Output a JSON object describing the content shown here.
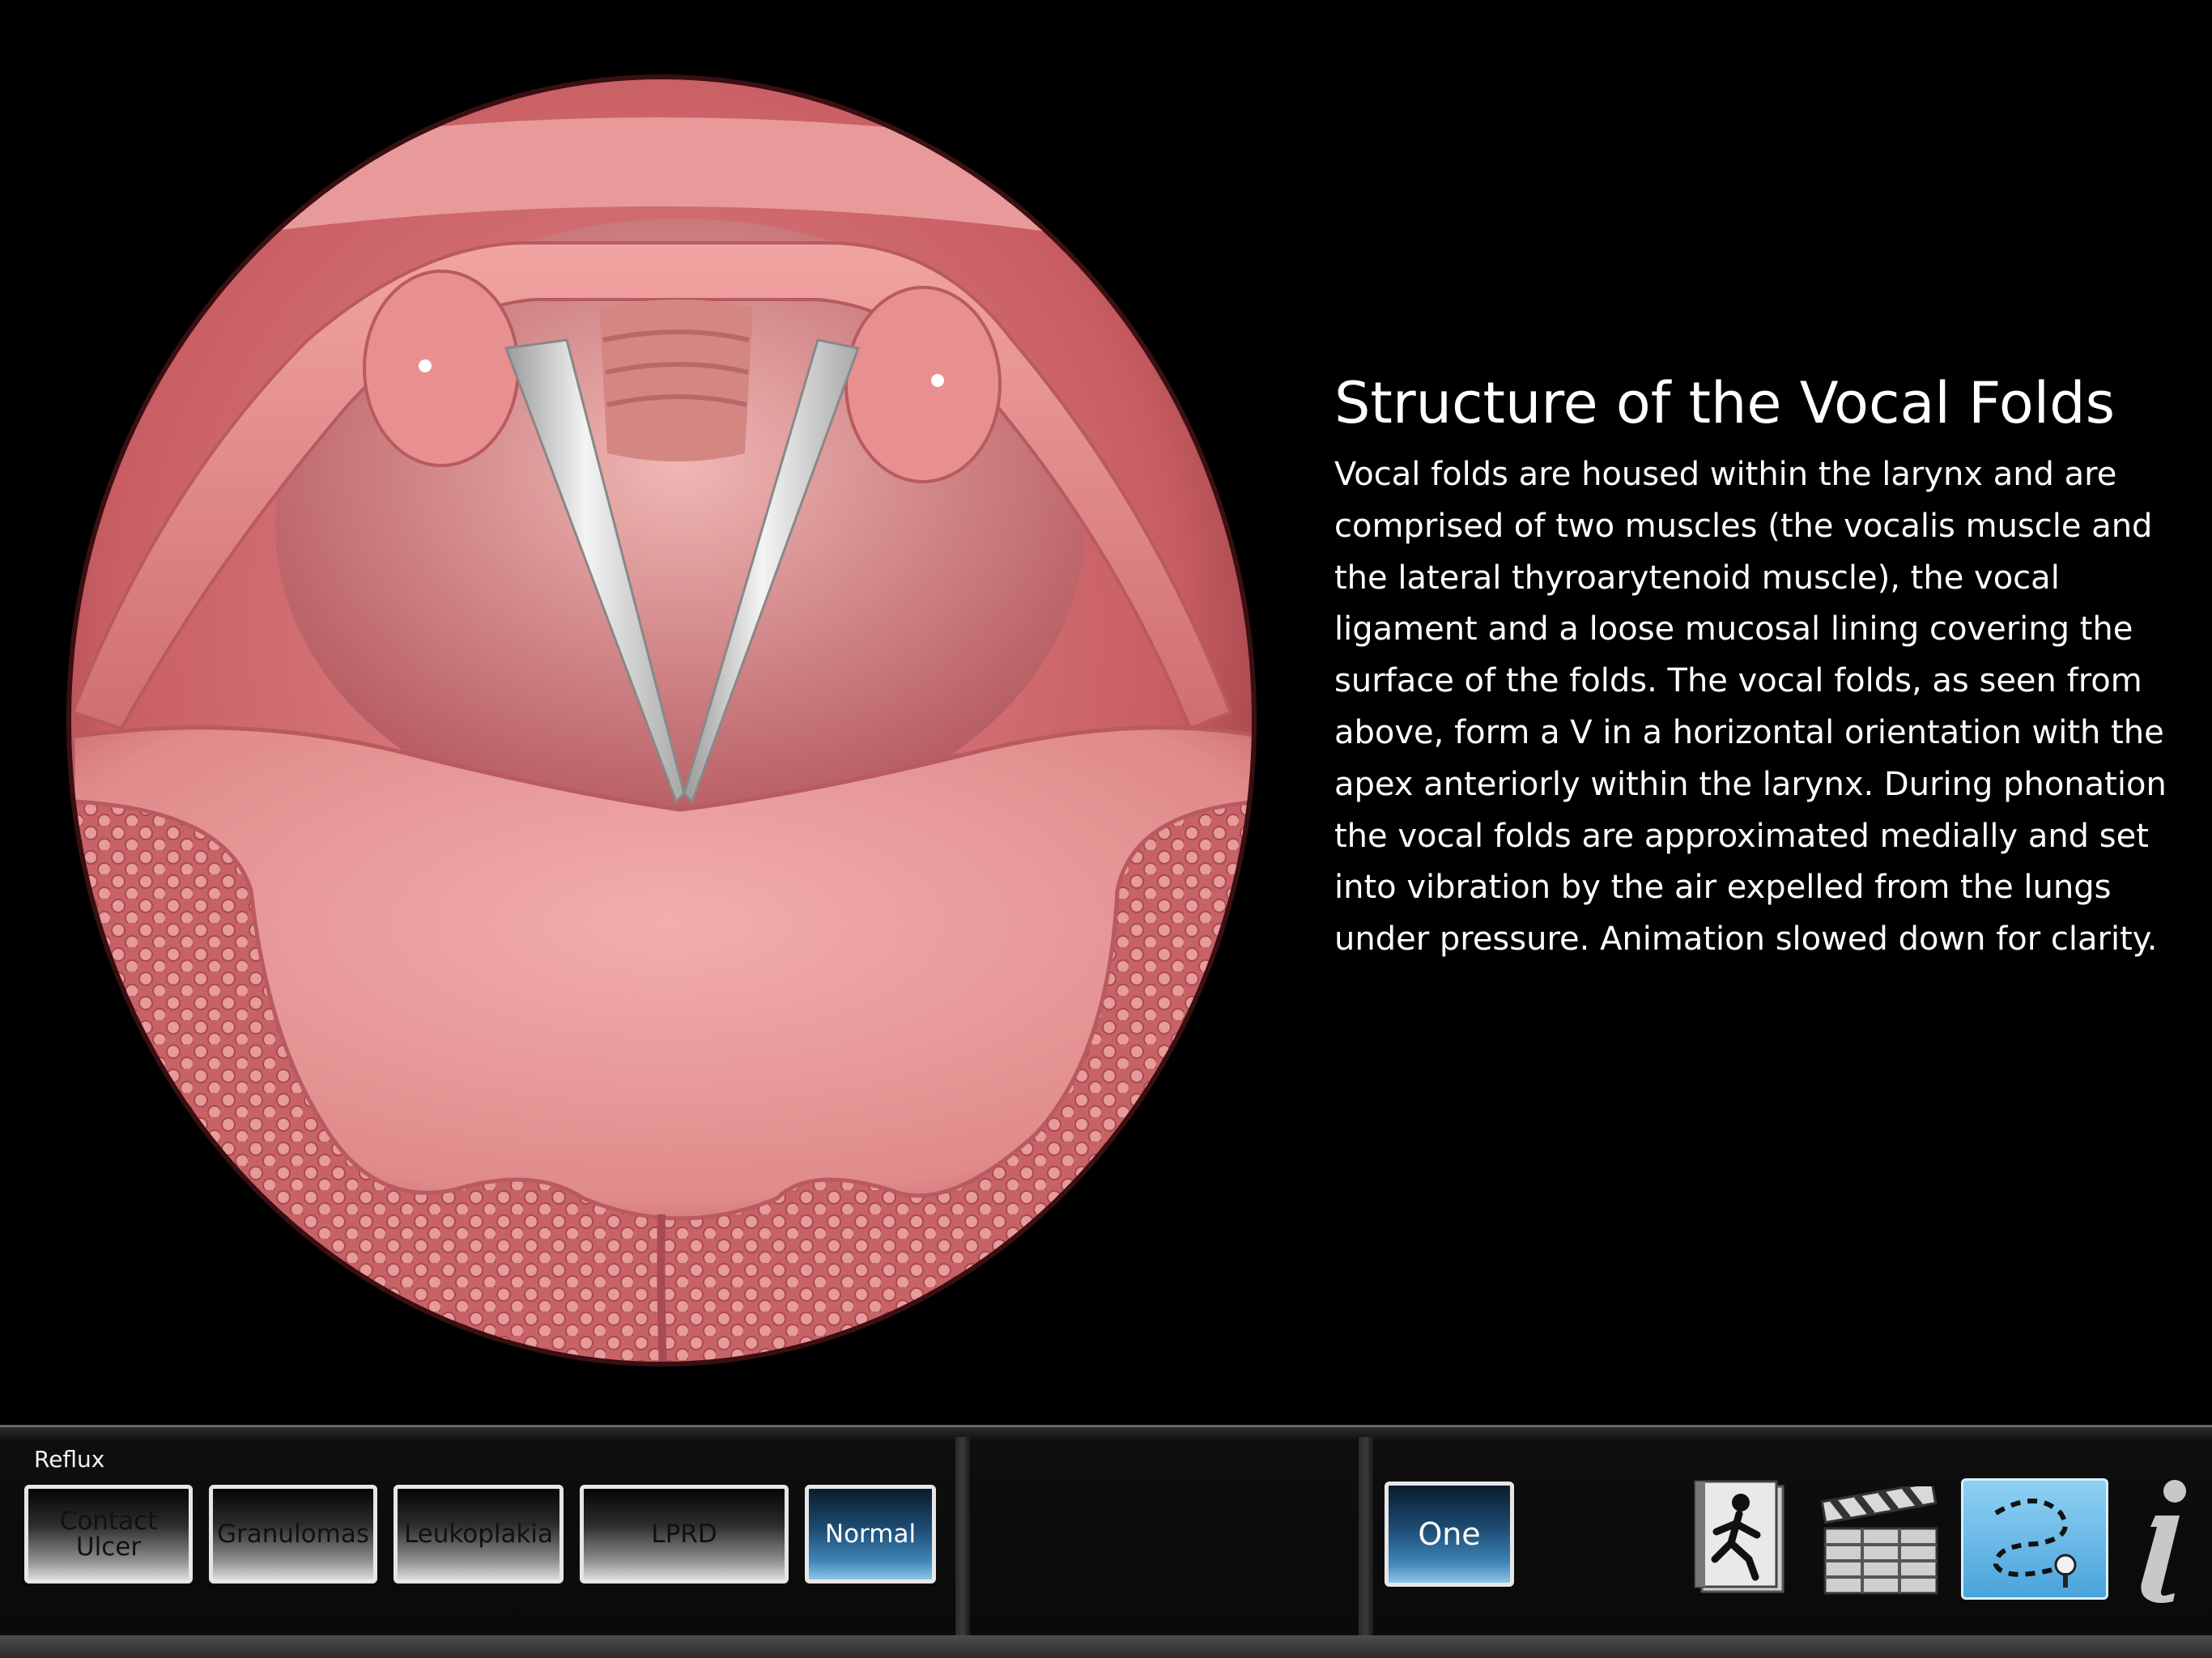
{
  "description": {
    "title": "Structure of the Vocal Folds",
    "lines": [
      "Vocal folds are housed within the larynx and are",
      "comprised of two muscles (the vocalis muscle and",
      "the lateral thyroarytenoid muscle), the vocal",
      "ligament and a loose mucosal lining covering the",
      "surface of the folds. The vocal folds, as seen from",
      "above, form a V in a horizontal orientation with the",
      "apex anteriorly within the larynx. During phonation",
      "the vocal folds are approximated medially and set",
      "into vibration by the air expelled from the lungs",
      "under pressure. Animation slowed down for clarity."
    ]
  },
  "toolbar": {
    "group_label": "Reflux",
    "condition_buttons": [
      {
        "label": "Contact\nUlcer",
        "selected": false
      },
      {
        "label": "Granulomas",
        "selected": false
      },
      {
        "label": "Leukoplakia",
        "selected": false
      },
      {
        "label": "LPRD",
        "selected": false
      },
      {
        "label": "Normal",
        "selected": true
      }
    ],
    "view_button": {
      "label": "One",
      "selected": true
    },
    "icons": [
      "animation-runner-icon",
      "clapperboard-icon",
      "draw-path-icon",
      "info-icon"
    ]
  },
  "colors": {
    "background": "#000000",
    "tissue": "#d9777a",
    "vocal_fold": "#dcdcdc",
    "selected_button": "#3f86b8",
    "draw_button": "#5ab0e6"
  }
}
